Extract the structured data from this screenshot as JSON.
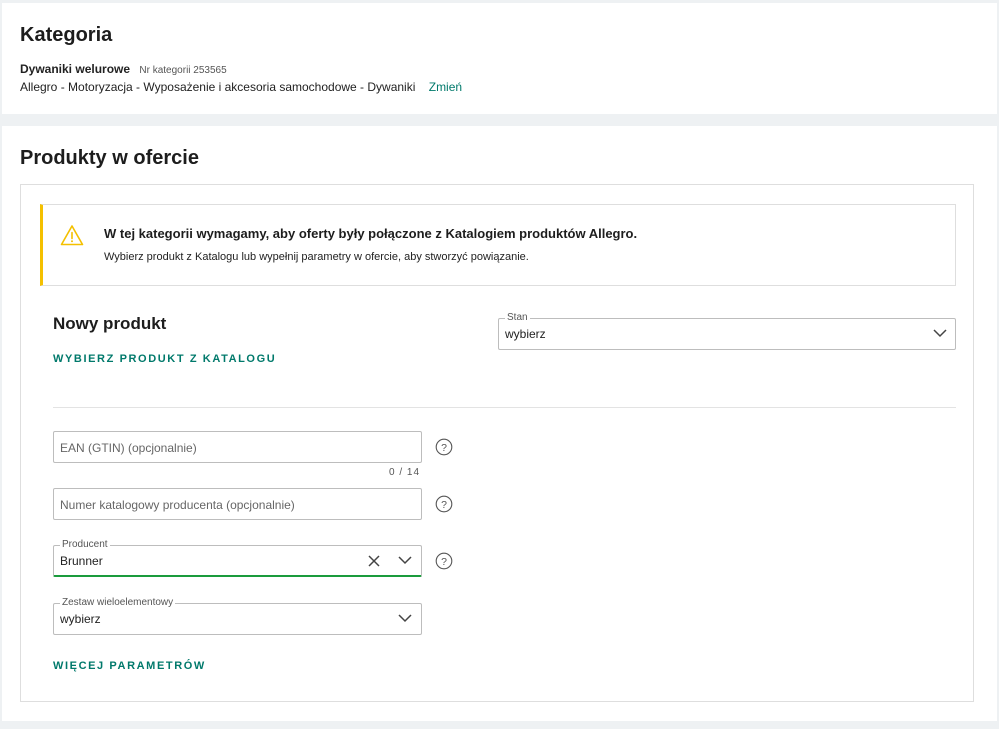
{
  "category": {
    "title": "Kategoria",
    "name": "Dywaniki welurowe",
    "nr": "Nr kategorii 253565",
    "path": "Allegro - Motoryzacja - Wyposażenie i akcesoria samochodowe - Dywaniki",
    "change_link": "Zmień"
  },
  "products": {
    "title": "Produkty w ofercie",
    "alert": {
      "title": "W tej kategorii wymagamy, aby oferty były połączone z Katalogiem produktów Allegro.",
      "text": "Wybierz produkt z Katalogu lub wypełnij parametry w ofercie, aby stworzyć powiązanie.",
      "icon": "warning-icon",
      "accent_color": "#f4c000"
    },
    "new_product": {
      "title": "Nowy produkt",
      "catalog_link": "WYBIERZ PRODUKT Z KATALOGU",
      "more_params_link": "WIĘCEJ PARAMETRÓW"
    },
    "fields": {
      "stan": {
        "label": "Stan",
        "value": "wybierz"
      },
      "ean": {
        "placeholder": "EAN (GTIN) (opcjonalnie)",
        "counter": "0 / 14"
      },
      "katalog": {
        "placeholder": "Numer katalogowy producenta (opcjonalnie)"
      },
      "producent": {
        "label": "Producent",
        "value": "Brunner"
      },
      "zestaw": {
        "label": "Zestaw wieloelementowy",
        "value": "wybierz"
      }
    }
  },
  "colors": {
    "link": "#00796b",
    "active_underline": "#1a9b3c"
  }
}
